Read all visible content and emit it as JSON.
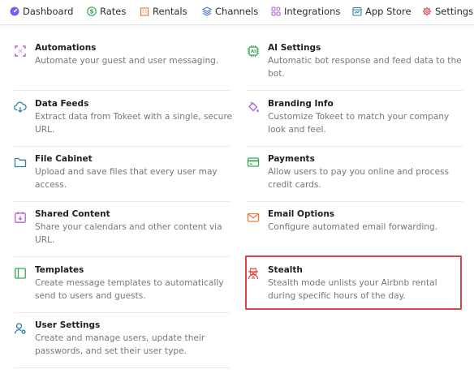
{
  "nav": {
    "items": [
      {
        "label": "Dashboard",
        "icon": "dashboard-icon",
        "color": "#7b5cf0"
      },
      {
        "label": "Rates",
        "icon": "dollar-icon",
        "color": "#3aa655"
      },
      {
        "label": "Rentals",
        "icon": "building-icon",
        "color": "#f07b3f"
      },
      {
        "label": "Channels",
        "icon": "layers-icon",
        "color": "#4a78c9"
      },
      {
        "label": "Integrations",
        "icon": "grid-icon",
        "color": "#b05fd6"
      },
      {
        "label": "App Store",
        "icon": "store-icon",
        "color": "#2f7fa8"
      },
      {
        "label": "Settings",
        "icon": "gear-icon",
        "color": "#e0474b"
      }
    ]
  },
  "settings": {
    "left": [
      {
        "title": "Automations",
        "description": "Automate your guest and user messaging.",
        "icon": "automation-icon",
        "color": "#b05fd6"
      },
      {
        "title": "Data Feeds",
        "description": "Extract data from Tokeet with a single, secure URL.",
        "icon": "cloud-download-icon",
        "color": "#2f7fa8"
      },
      {
        "title": "File Cabinet",
        "description": "Upload and save files that every user may access.",
        "icon": "folder-icon",
        "color": "#2f7fa8"
      },
      {
        "title": "Shared Content",
        "description": "Share your calendars and other content via URL.",
        "icon": "calendar-icon",
        "color": "#b05fd6"
      },
      {
        "title": "Templates",
        "description": "Create message templates to automatically send to users and guests.",
        "icon": "template-icon",
        "color": "#3aa655"
      },
      {
        "title": "User Settings",
        "description": "Create and manage users, update their passwords, and set their user type.",
        "icon": "user-gear-icon",
        "color": "#2f7fa8"
      }
    ],
    "right": [
      {
        "title": "AI Settings",
        "description": "Automatic bot response and feed data to the bot.",
        "icon": "ai-chip-icon",
        "color": "#3aa655"
      },
      {
        "title": "Branding Info",
        "description": "Customize Tokeet to match your company look and feel.",
        "icon": "paint-bucket-icon",
        "color": "#b05fd6"
      },
      {
        "title": "Payments",
        "description": "Allow users to pay you online and process credit cards.",
        "icon": "credit-card-icon",
        "color": "#3aa655"
      },
      {
        "title": "Email Options",
        "description": "Configure automated email forwarding.",
        "icon": "envelope-icon",
        "color": "#f07b3f"
      },
      {
        "title": "Stealth",
        "description": "Stealth mode unlists your Airbnb rental during specific hours of the day.",
        "icon": "spy-icon",
        "color": "#e0474b"
      }
    ]
  },
  "highlight_color": "#d9474b"
}
